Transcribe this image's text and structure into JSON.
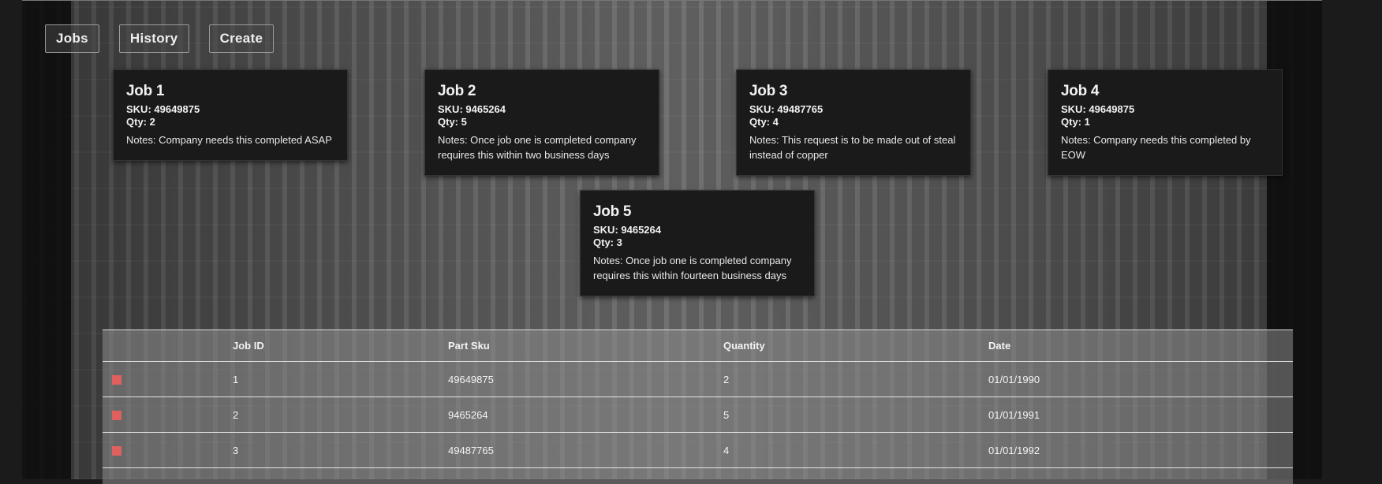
{
  "nav": {
    "items": [
      "Jobs",
      "History",
      "Create"
    ]
  },
  "jobs": [
    {
      "title": "Job 1",
      "sku": "SKU: 49649875",
      "qty": "Qty: 2",
      "notes": "Notes: Company needs this completed ASAP"
    },
    {
      "title": "Job 2",
      "sku": "SKU: 9465264",
      "qty": "Qty: 5",
      "notes": "Notes: Once job one is completed company requires this within two business days"
    },
    {
      "title": "Job 3",
      "sku": "SKU: 49487765",
      "qty": "Qty: 4",
      "notes": "Notes: This request is to be made out of steal instead of copper"
    },
    {
      "title": "Job 4",
      "sku": "SKU: 49649875",
      "qty": "Qty: 1",
      "notes": "Notes: Company needs this completed by EOW"
    },
    {
      "title": "Job 5",
      "sku": "SKU: 9465264",
      "qty": "Qty: 3",
      "notes": "Notes: Once job one is completed company requires this within fourteen business days"
    }
  ],
  "table": {
    "headers": [
      "",
      "Job ID",
      "Part Sku",
      "Quantity",
      "Date"
    ],
    "rows": [
      {
        "id": "1",
        "sku": "49649875",
        "qty": "2",
        "date": "01/01/1990"
      },
      {
        "id": "2",
        "sku": "9465264",
        "qty": "5",
        "date": "01/01/1991"
      },
      {
        "id": "3",
        "sku": "49487765",
        "qty": "4",
        "date": "01/01/1992"
      }
    ]
  },
  "colors": {
    "marker": "#e06060",
    "card_bg": "#1a1a1a"
  }
}
